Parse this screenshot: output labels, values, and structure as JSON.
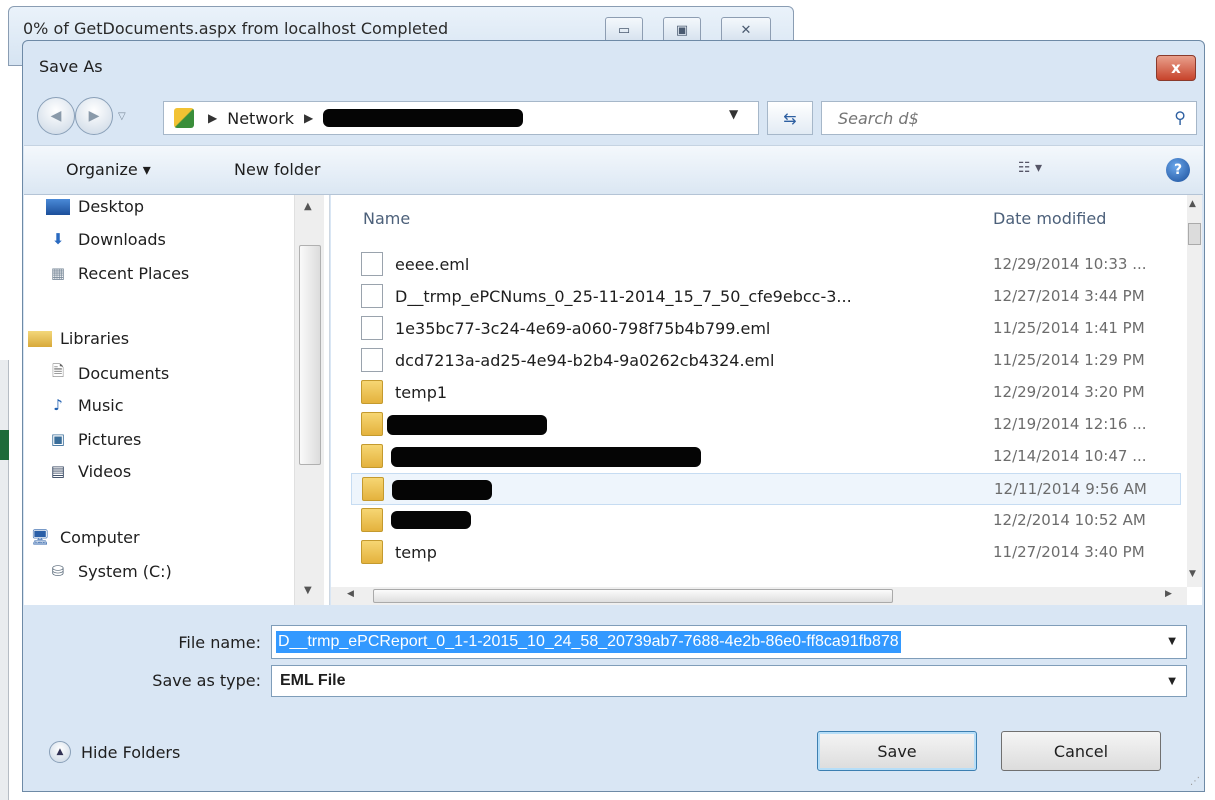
{
  "progress_window": {
    "title": "0% of GetDocuments.aspx from localhost Completed"
  },
  "dialog": {
    "title": "Save As",
    "close_label": "x",
    "address": {
      "breadcrumb_root": "Network"
    },
    "search": {
      "placeholder": "Search d$"
    },
    "toolbar": {
      "organize": "Organize ▾",
      "new_folder": "New folder",
      "views": "☷ ▾",
      "help": "?"
    },
    "nav_pane": {
      "items": [
        {
          "label": "Desktop"
        },
        {
          "label": "Downloads"
        },
        {
          "label": "Recent Places"
        },
        {
          "label": "Libraries"
        },
        {
          "label": "Documents"
        },
        {
          "label": "Music"
        },
        {
          "label": "Pictures"
        },
        {
          "label": "Videos"
        },
        {
          "label": "Computer"
        },
        {
          "label": "System (C:)"
        }
      ]
    },
    "file_list": {
      "columns": {
        "name": "Name",
        "date": "Date modified"
      },
      "rows": [
        {
          "name": "eeee.eml",
          "date": "12/29/2014 10:33 ..."
        },
        {
          "name": "D__trmp_ePCNums_0_25-11-2014_15_7_50_cfe9ebcc-3...",
          "date": "12/27/2014 3:44 PM"
        },
        {
          "name": "1e35bc77-3c24-4e69-a060-798f75b4b799.eml",
          "date": "11/25/2014 1:41 PM"
        },
        {
          "name": "dcd7213a-ad25-4e94-b2b4-9a0262cb4324.eml",
          "date": "11/25/2014 1:29 PM"
        },
        {
          "name": "temp1",
          "date": "12/29/2014 3:20 PM"
        },
        {
          "name": "",
          "date": "12/19/2014 12:16 ..."
        },
        {
          "name": "",
          "date": "12/14/2014 10:47 ..."
        },
        {
          "name": "",
          "date": "12/11/2014 9:56 AM"
        },
        {
          "name": "",
          "date": "12/2/2014 10:52 AM"
        },
        {
          "name": "temp",
          "date": "11/27/2014 3:40 PM"
        }
      ]
    },
    "file_name": {
      "label": "File name:",
      "value": "D__trmp_ePCReport_0_1-1-2015_10_24_58_20739ab7-7688-4e2b-86e0-ff8ca91fb878"
    },
    "save_as_type": {
      "label": "Save as type:",
      "value": "EML File"
    },
    "hide_folders": "Hide Folders",
    "save": "Save",
    "cancel": "Cancel"
  }
}
